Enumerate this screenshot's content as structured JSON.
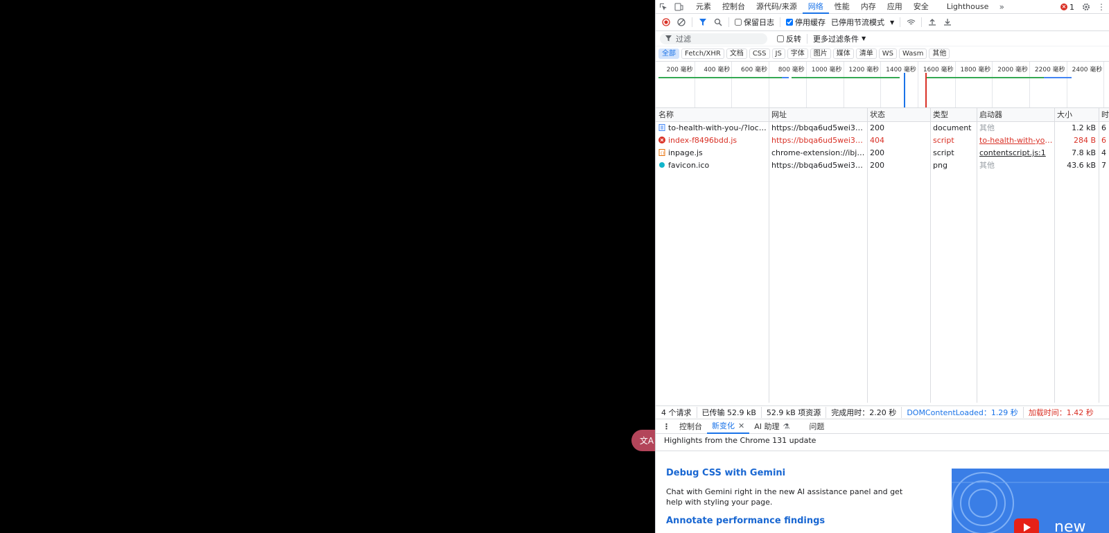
{
  "panel_tabs": [
    "元素",
    "控制台",
    "源代码/来源",
    "网络",
    "性能",
    "内存",
    "应用",
    "安全",
    "Lighthouse"
  ],
  "active_panel": "网络",
  "error_count": "1",
  "toolbar": {
    "preserve_log": "保留日志",
    "disable_cache": "停用缓存",
    "throttle": "已停用节流模式"
  },
  "filter": {
    "placeholder": "过滤",
    "invert": "反转",
    "more_filters": "更多过滤条件"
  },
  "type_filters": [
    "全部",
    "Fetch/XHR",
    "文档",
    "CSS",
    "JS",
    "字体",
    "图片",
    "媒体",
    "清单",
    "WS",
    "Wasm",
    "其他"
  ],
  "timeline_ticks": [
    "200 毫秒",
    "400 毫秒",
    "600 毫秒",
    "800 毫秒",
    "1000 毫秒",
    "1200 毫秒",
    "1400 毫秒",
    "1600 毫秒",
    "1800 毫秒",
    "2000 毫秒",
    "2200 毫秒",
    "2400 毫秒"
  ],
  "columns": [
    "名称",
    "网址",
    "状态",
    "类型",
    "启动器",
    "大小",
    "时"
  ],
  "requests": [
    {
      "name": "to-health-with-you-/?local...",
      "url": "https://bbqa6ud5wei3v6c...",
      "status": "200",
      "type": "document",
      "initiator": "其他",
      "size": "1.2 kB",
      "time": "6",
      "icon": "document-icon",
      "error": false
    },
    {
      "name": "index-f8496bdd.js",
      "url": "https://bbqa6ud5wei3v6c...",
      "status": "404",
      "type": "script",
      "initiator": "to-health-with-you-/?l",
      "size": "284 B",
      "time": "6",
      "icon": "error-icon",
      "error": true
    },
    {
      "name": "inpage.js",
      "url": "chrome-extension://ibjflp...",
      "status": "200",
      "type": "script",
      "initiator": "contentscript.js:1",
      "size": "7.8 kB",
      "time": "4",
      "icon": "script-icon",
      "error": false
    },
    {
      "name": "favicon.ico",
      "url": "https://bbqa6ud5wei3v6c...",
      "status": "200",
      "type": "png",
      "initiator": "其他",
      "size": "43.6 kB",
      "time": "7",
      "icon": "image-icon",
      "error": false
    }
  ],
  "summary": {
    "requests": "4 个请求",
    "transferred": "已传输 52.9 kB",
    "resources": "52.9 kB 项资源",
    "finish": "完成用时：2.20 秒",
    "dcl": "DOMContentLoaded：1.29 秒",
    "load": "加载时间：1.42 秒"
  },
  "drawer_tabs": {
    "console": "控制台",
    "whats_new": "新变化",
    "ai": "AI 助理",
    "issues": "问题"
  },
  "whats_new": {
    "header": "Highlights from the Chrome 131 update",
    "item1_title": "Debug CSS with Gemini",
    "item1_desc": "Chat with Gemini right in the new AI assistance panel and get help with styling your page.",
    "item2_title": "Annotate performance findings",
    "promo_text": "new"
  },
  "colors": {
    "accent": "#1a73e8",
    "error": "#d93025",
    "dcl_line": "#1a73e8",
    "load_line": "#d93025"
  }
}
